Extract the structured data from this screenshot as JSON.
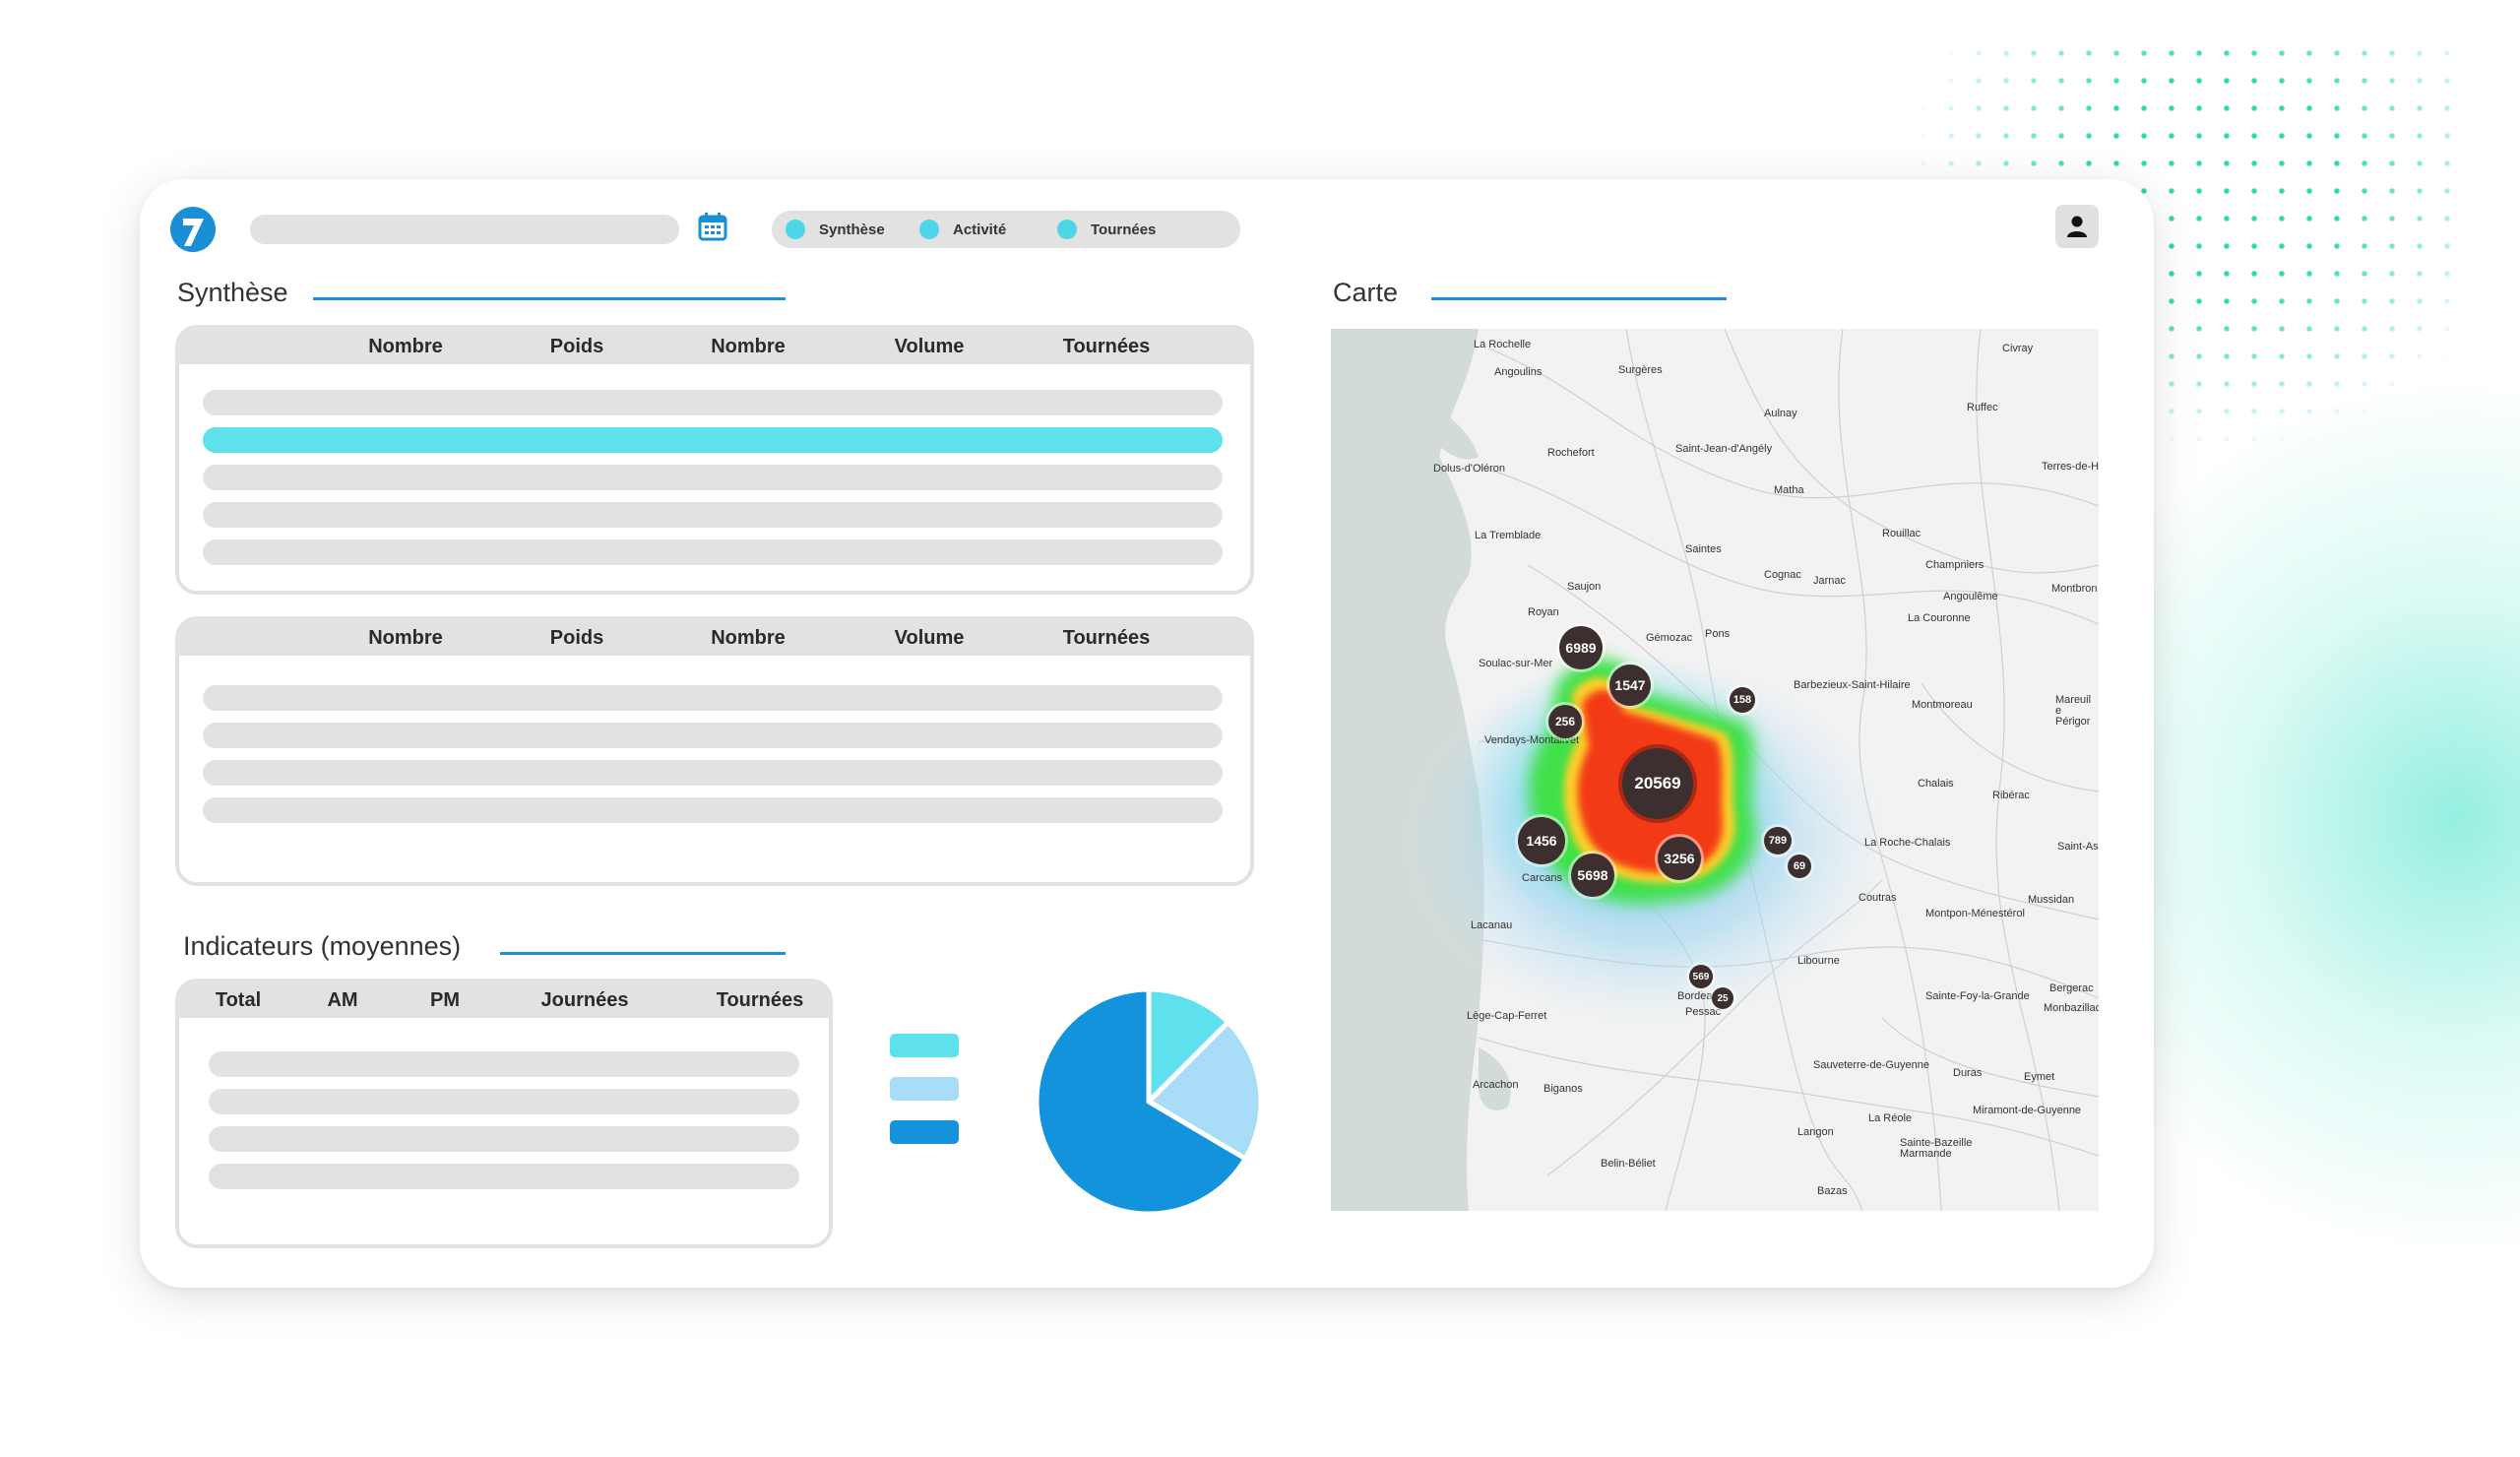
{
  "header": {
    "tabs": [
      {
        "label": "Synthèse"
      },
      {
        "label": "Activité"
      },
      {
        "label": "Tournées"
      }
    ],
    "icons": [
      "logo-7",
      "calendar-icon",
      "user-icon"
    ]
  },
  "synthese": {
    "title": "Synthèse",
    "table1": {
      "headers": [
        "Nombre",
        "Poids",
        "Nombre",
        "Volume",
        "Tournées"
      ]
    },
    "table2": {
      "headers": [
        "Nombre",
        "Poids",
        "Nombre",
        "Volume",
        "Tournées"
      ]
    }
  },
  "indicateurs": {
    "title": "Indicateurs (moyennes)",
    "headers": [
      "Total",
      "AM",
      "PM",
      "Journées",
      "Tournées"
    ]
  },
  "pie": {
    "slices": [
      {
        "fraction": 0.125,
        "color": "#5ee0ed"
      },
      {
        "fraction": 0.21,
        "color": "#a9dcf7"
      },
      {
        "fraction": 0.665,
        "color": "#1293dc"
      }
    ]
  },
  "carte": {
    "title": "Carte",
    "clusters": [
      {
        "label": "6989"
      },
      {
        "label": "1547"
      },
      {
        "label": "158"
      },
      {
        "label": "256"
      },
      {
        "label": "20569"
      },
      {
        "label": "1456"
      },
      {
        "label": "5698"
      },
      {
        "label": "3256"
      },
      {
        "label": "789"
      },
      {
        "label": "69"
      },
      {
        "label": "569"
      },
      {
        "label": "25"
      }
    ],
    "places": [
      "La Rochelle",
      "Civray",
      "Angoulins",
      "Surgères",
      "Aulnay",
      "Ruffec",
      "Rochefort",
      "Saint-Jean-d'Angély",
      "Dolus-d'Oléron",
      "Terres-de-H",
      "Matha",
      "La Tremblade",
      "Rouillac",
      "Saintes",
      "Champniers",
      "Cognac",
      "Jarnac",
      "Saujon",
      "Angoulême",
      "Montbron",
      "Royan",
      "La Couronne",
      "Gémozac",
      "Pons",
      "Barbezieux-Saint-Hilaire",
      "Soulac-sur-Mer",
      "Montmoreau",
      "Mareuil e Périgor",
      "Vendays-Montalivet",
      "Chalais",
      "Ribérac",
      "La Roche-Chalais",
      "Saint-As",
      "Carcans",
      "Coutras",
      "Mussidan",
      "Montpon-Ménestérol",
      "Lacanau",
      "Libourne",
      "Lège-Cap-Ferret",
      "Bordeaux",
      "Pessac",
      "Sainte-Foy-la-Grande",
      "Bergerac",
      "Monbazillac",
      "Arcachon",
      "Biganos",
      "Sauveterre-de-Guyenne",
      "Duras",
      "Eymet",
      "Miramont-de-Guyenne",
      "La Réole",
      "Langon",
      "Sainte-Bazeille Marmande",
      "Belin-Béliet",
      "Bazas"
    ]
  }
}
